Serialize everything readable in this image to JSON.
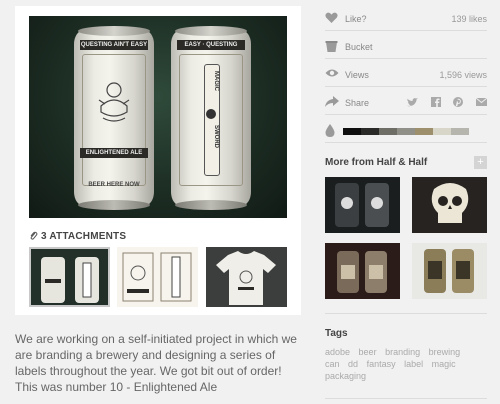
{
  "attachments": {
    "label": "3 ATTACHMENTS"
  },
  "description": "We are working on a self-initiated project in which we are branding a brewery and designing a series of labels throughout the year. We got bit out of order! This was number 10 - Enlightened Ale",
  "cans": {
    "left_top_text": "QUESTING AIN'T EASY",
    "left_label": "ENLIGHTENED ALE",
    "left_bottom": "BEER HERE NOW",
    "right_top_text": "EASY · QUESTING",
    "right_sword_top": "MAGIC",
    "right_sword_bottom": "SWORD"
  },
  "stats": {
    "like_label": "Like?",
    "likes": "139 likes",
    "bucket_label": "Bucket",
    "views_label": "Views",
    "views": "1,596 views",
    "share_label": "Share"
  },
  "palette": [
    "#0f0f0f",
    "#2a2a28",
    "#6e6d66",
    "#908f88",
    "#9e8f6c",
    "#d8d6c8",
    "#b7b6ae"
  ],
  "more_from": {
    "title": "More from Half & Half",
    "plus": "+"
  },
  "tags": {
    "title": "Tags",
    "items": [
      "adobe",
      "beer",
      "branding",
      "brewing",
      "can",
      "dd",
      "fantasy",
      "label",
      "magic",
      "packaging"
    ]
  },
  "icons": {
    "like": "heart-icon",
    "bucket": "bucket-icon",
    "views": "eye-icon",
    "share": "share-arrow-icon",
    "palette": "drop-icon",
    "twitter": "twitter-icon",
    "facebook": "facebook-icon",
    "pinterest": "pinterest-icon",
    "email": "email-icon",
    "attachment": "paperclip-icon"
  }
}
